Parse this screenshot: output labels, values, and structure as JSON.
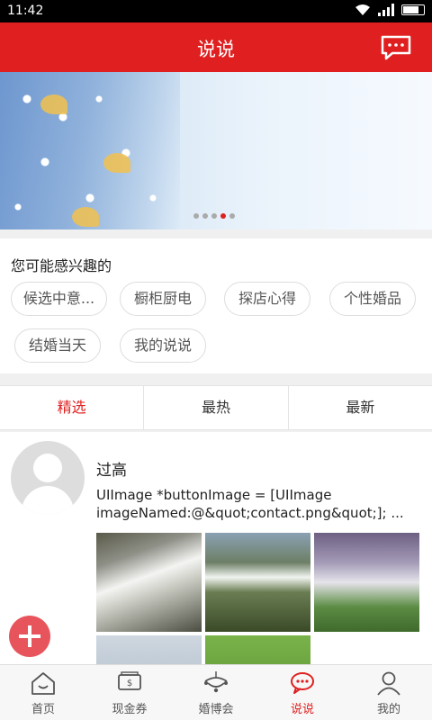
{
  "status_bar": {
    "time": "11:42"
  },
  "header": {
    "title": "说说",
    "chat_icon": "chat-bubble-icon"
  },
  "banner": {
    "slide_count": 5,
    "active_index": 3
  },
  "interest": {
    "title": "您可能感兴趣的",
    "tags": [
      "候选中意...",
      "橱柜厨电",
      "探店心得",
      "个性婚品",
      "结婚当天",
      "我的说说"
    ]
  },
  "tabs": {
    "items": [
      "精选",
      "最热",
      "最新"
    ],
    "active": 0
  },
  "post": {
    "user": "过高",
    "text": "UIImage *buttonImage = [UIImage imageNamed:@&quot;contact.png&quot;]; ..."
  },
  "bottom_nav": {
    "items": [
      {
        "label": "首页",
        "icon": "home-icon"
      },
      {
        "label": "现金券",
        "icon": "coupon-icon"
      },
      {
        "label": "婚博会",
        "icon": "chandelier-icon"
      },
      {
        "label": "说说",
        "icon": "chat-icon"
      },
      {
        "label": "我的",
        "icon": "user-icon"
      }
    ],
    "active": 3
  },
  "colors": {
    "brand": "#e02020",
    "fab": "#e8545c"
  }
}
